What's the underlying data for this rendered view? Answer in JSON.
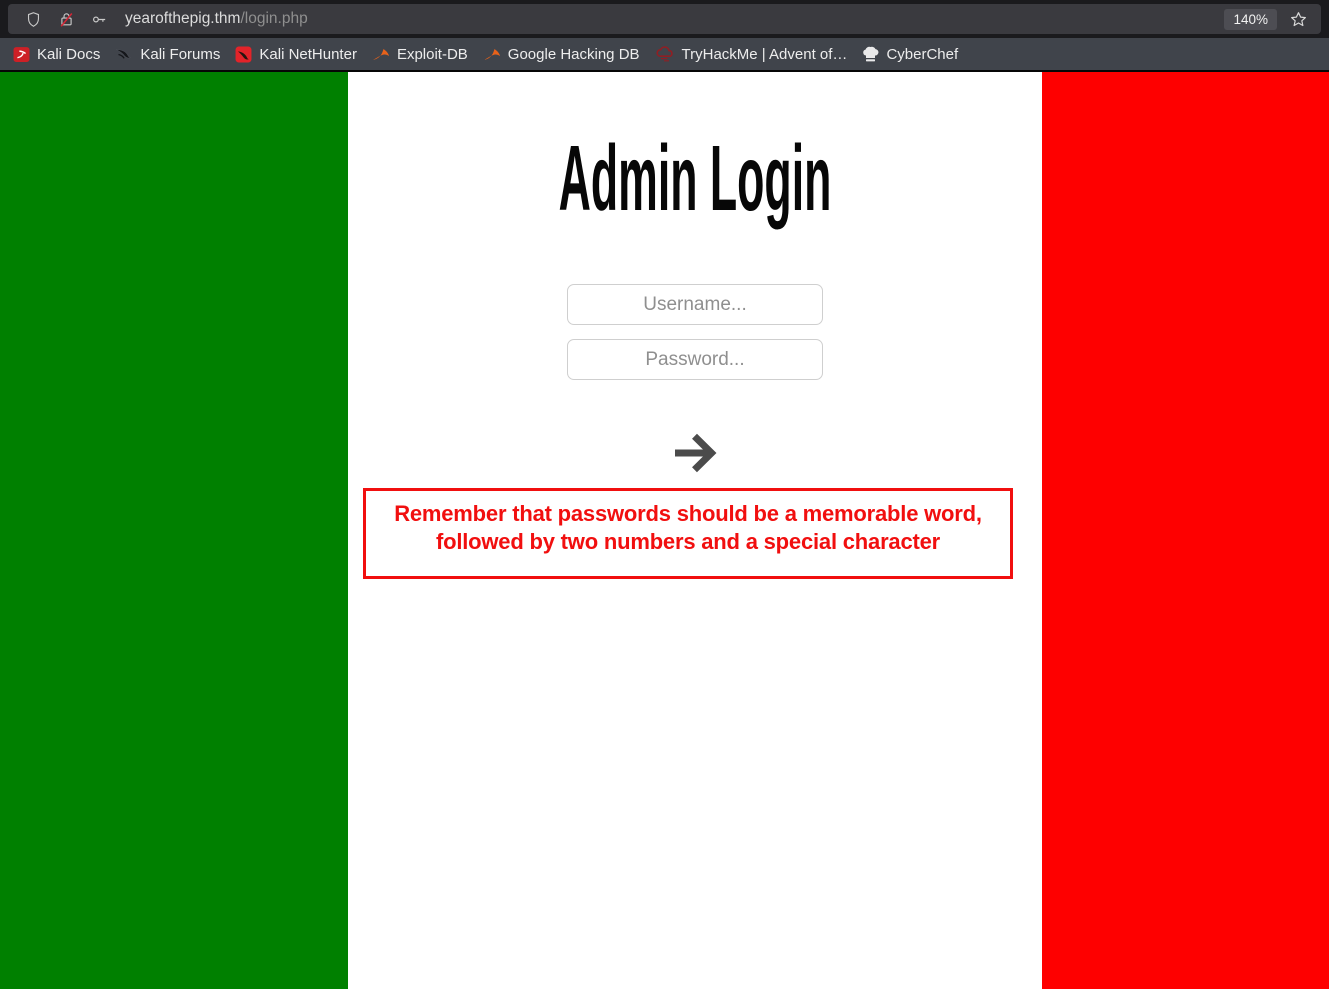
{
  "browser": {
    "url_domain": "yearofthepig.thm",
    "url_path": "/login.php",
    "zoom_level": "140%",
    "bookmarks": [
      {
        "label": "Kali Docs"
      },
      {
        "label": "Kali Forums"
      },
      {
        "label": "Kali NetHunter"
      },
      {
        "label": "Exploit-DB"
      },
      {
        "label": "Google Hacking DB"
      },
      {
        "label": "TryHackMe | Advent of…"
      },
      {
        "label": "CyberChef"
      }
    ]
  },
  "page": {
    "title": "Admin Login",
    "form": {
      "username_placeholder": "Username...",
      "password_placeholder": "Password..."
    },
    "notice": {
      "line1": "Remember that passwords should be a memorable word,",
      "line2": "followed by two numbers and a special character"
    },
    "colors": {
      "flag_green": "#008000",
      "flag_red": "#fe0000",
      "notice_red": "#f10f0f",
      "chrome_dark": "#1a1a1d",
      "urlbar_field": "#3a3a3f",
      "bookmarks_bar": "#40444b"
    }
  }
}
